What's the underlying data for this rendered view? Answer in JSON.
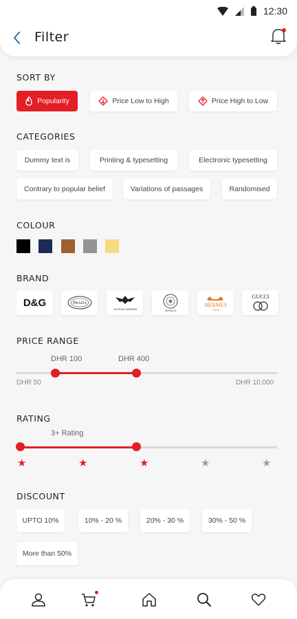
{
  "status": {
    "time": "12:30"
  },
  "header": {
    "title": "Filter"
  },
  "sort_by": {
    "title": "SORT BY",
    "options": [
      "Popularity",
      "Price Low to High",
      "Price High to Low"
    ]
  },
  "categories": {
    "title": "CATEGORIES",
    "items": [
      "Dummy text is",
      "Printing & typesetting",
      "Electronic typesetting",
      "Contrary to popular belief",
      "Variations of passages",
      "Randomised"
    ]
  },
  "colour": {
    "title": "COLOUR",
    "swatches": [
      "#000000",
      "#1c2b55",
      "#a0602c",
      "#949494",
      "#f6dc80"
    ]
  },
  "brand": {
    "title": "BRAND",
    "items": [
      "D&G",
      "PRADA",
      "GIORGIO ARMANI",
      "VERSACE",
      "HERMES",
      "GUCCI"
    ]
  },
  "price_range": {
    "title": "PRICE RANGE",
    "selected_min": "DHR 100",
    "selected_max": "DHR 400",
    "min": "DHR 50",
    "max": "DHR 10,000"
  },
  "rating": {
    "title": "RATING",
    "label": "3+ Rating",
    "value": 3,
    "max": 5
  },
  "discount": {
    "title": "DISCOUNT",
    "items": [
      "UPTO 10%",
      "10% - 20 %",
      "20% - 30 %",
      "30% - 50 %",
      "More than 50%"
    ]
  },
  "colors": {
    "accent": "#e31e24",
    "star_off": "#9e9e9e"
  },
  "nav": {
    "icons": [
      "user-icon",
      "cart-icon",
      "home-icon",
      "search-icon",
      "heart-icon"
    ]
  }
}
